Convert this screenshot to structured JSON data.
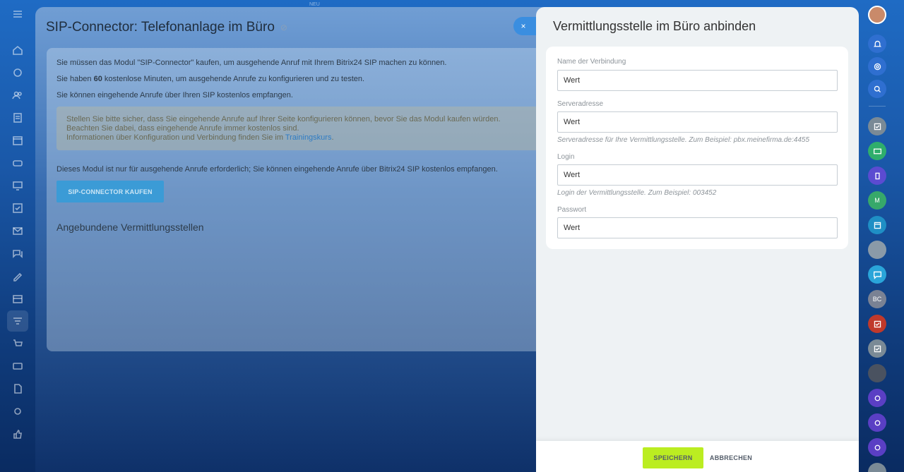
{
  "top_tiny_text": "NEU",
  "background_page": {
    "title": "SIP-Connector: Telefonanlage im Büro",
    "line1": "Sie müssen das Modul \"SIP-Connector\" kaufen, um ausgehende Anruf mit Ihrem Bitrix24 SIP machen zu können.",
    "line2_prefix": "Sie haben ",
    "line2_bold": "60",
    "line2_suffix": " kostenlose Minuten, um ausgehende Anrufe zu konfigurieren und zu testen.",
    "line3": "Sie können eingehende Anrufe über Ihren SIP kostenlos empfangen.",
    "notice_line1": "Stellen Sie bitte sicher, dass Sie eingehende Anrufe auf Ihrer Seite konfigurieren können, bevor Sie das Modul kaufen würden.",
    "notice_line2": "Beachten Sie dabei, dass eingehende Anrufe immer kostenlos sind.",
    "notice_line3_prefix": "Informationen über Konfiguration und Verbindung finden Sie im ",
    "notice_link": "Trainingskurs",
    "notice_line3_suffix": ".",
    "module_text": "Dieses Modul ist nur für ausgehende Anrufe erforderlich; Sie können eingehende Anrufe über Bitrix24 SIP kostenlos empfangen.",
    "buy_button": "SIP-CONNECTOR KAUFEN",
    "section_title": "Angebundene Vermittlungsstellen"
  },
  "close_label": "×",
  "panel": {
    "title": "Vermittlungsstelle im Büro anbinden",
    "fields": [
      {
        "label": "Name der Verbindung",
        "value": "Wert",
        "hint": ""
      },
      {
        "label": "Serveradresse",
        "value": "Wert",
        "hint": "Serveradresse für Ihre Vermittlungsstelle. Zum Beispiel: pbx.meinefirma.de:4455"
      },
      {
        "label": "Login",
        "value": "Wert",
        "hint": "Login der Vermittlungsstelle. Zum Beispiel: 003452"
      },
      {
        "label": "Passwort",
        "value": "Wert",
        "hint": ""
      }
    ],
    "save_label": "SPEICHERN",
    "cancel_label": "ABBRECHEN"
  },
  "right_bar": {
    "avatar_initials_m": "M",
    "avatar_initials_bc": "BC"
  },
  "colors": {
    "accent_green": "#bbed21",
    "close_blue": "#3a8ee0",
    "link_blue": "#2f7cc4"
  }
}
